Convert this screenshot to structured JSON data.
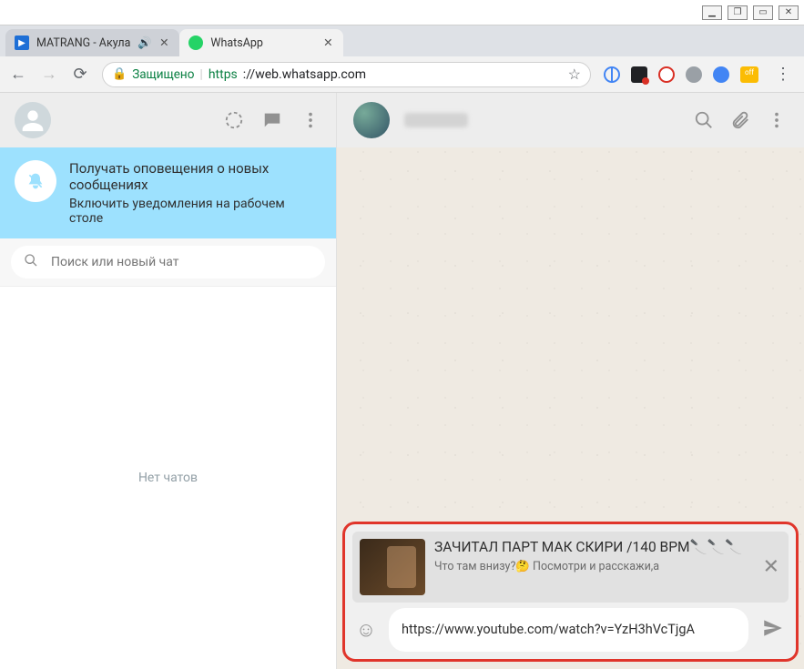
{
  "window": {
    "minimize": "—",
    "maximize": "▭",
    "close": "✕",
    "restore": "❐"
  },
  "tabs": [
    {
      "label": "MATRANG - Акула",
      "audio": true
    },
    {
      "label": "WhatsApp",
      "audio": false
    }
  ],
  "toolbar": {
    "secure_label": "Защищено",
    "url_https": "https",
    "url_rest": "://web.whatsapp.com",
    "ext_badge": "off"
  },
  "left_panel": {
    "notification": {
      "title": "Получать оповещения о новых сообщениях",
      "subtitle": "Включить уведомления на рабочем столе"
    },
    "search_placeholder": "Поиск или новый чат",
    "empty_label": "Нет чатов"
  },
  "composer": {
    "preview_title": "ЗАЧИТАЛ ПАРТ МАК СКИРИ /140 BPM🔪🔪🔪",
    "preview_desc": "Что там внизу?🤔 Посмотри и расскажи,а",
    "input_value": "https://www.youtube.com/watch?v=YzH3hVcTjgA"
  }
}
